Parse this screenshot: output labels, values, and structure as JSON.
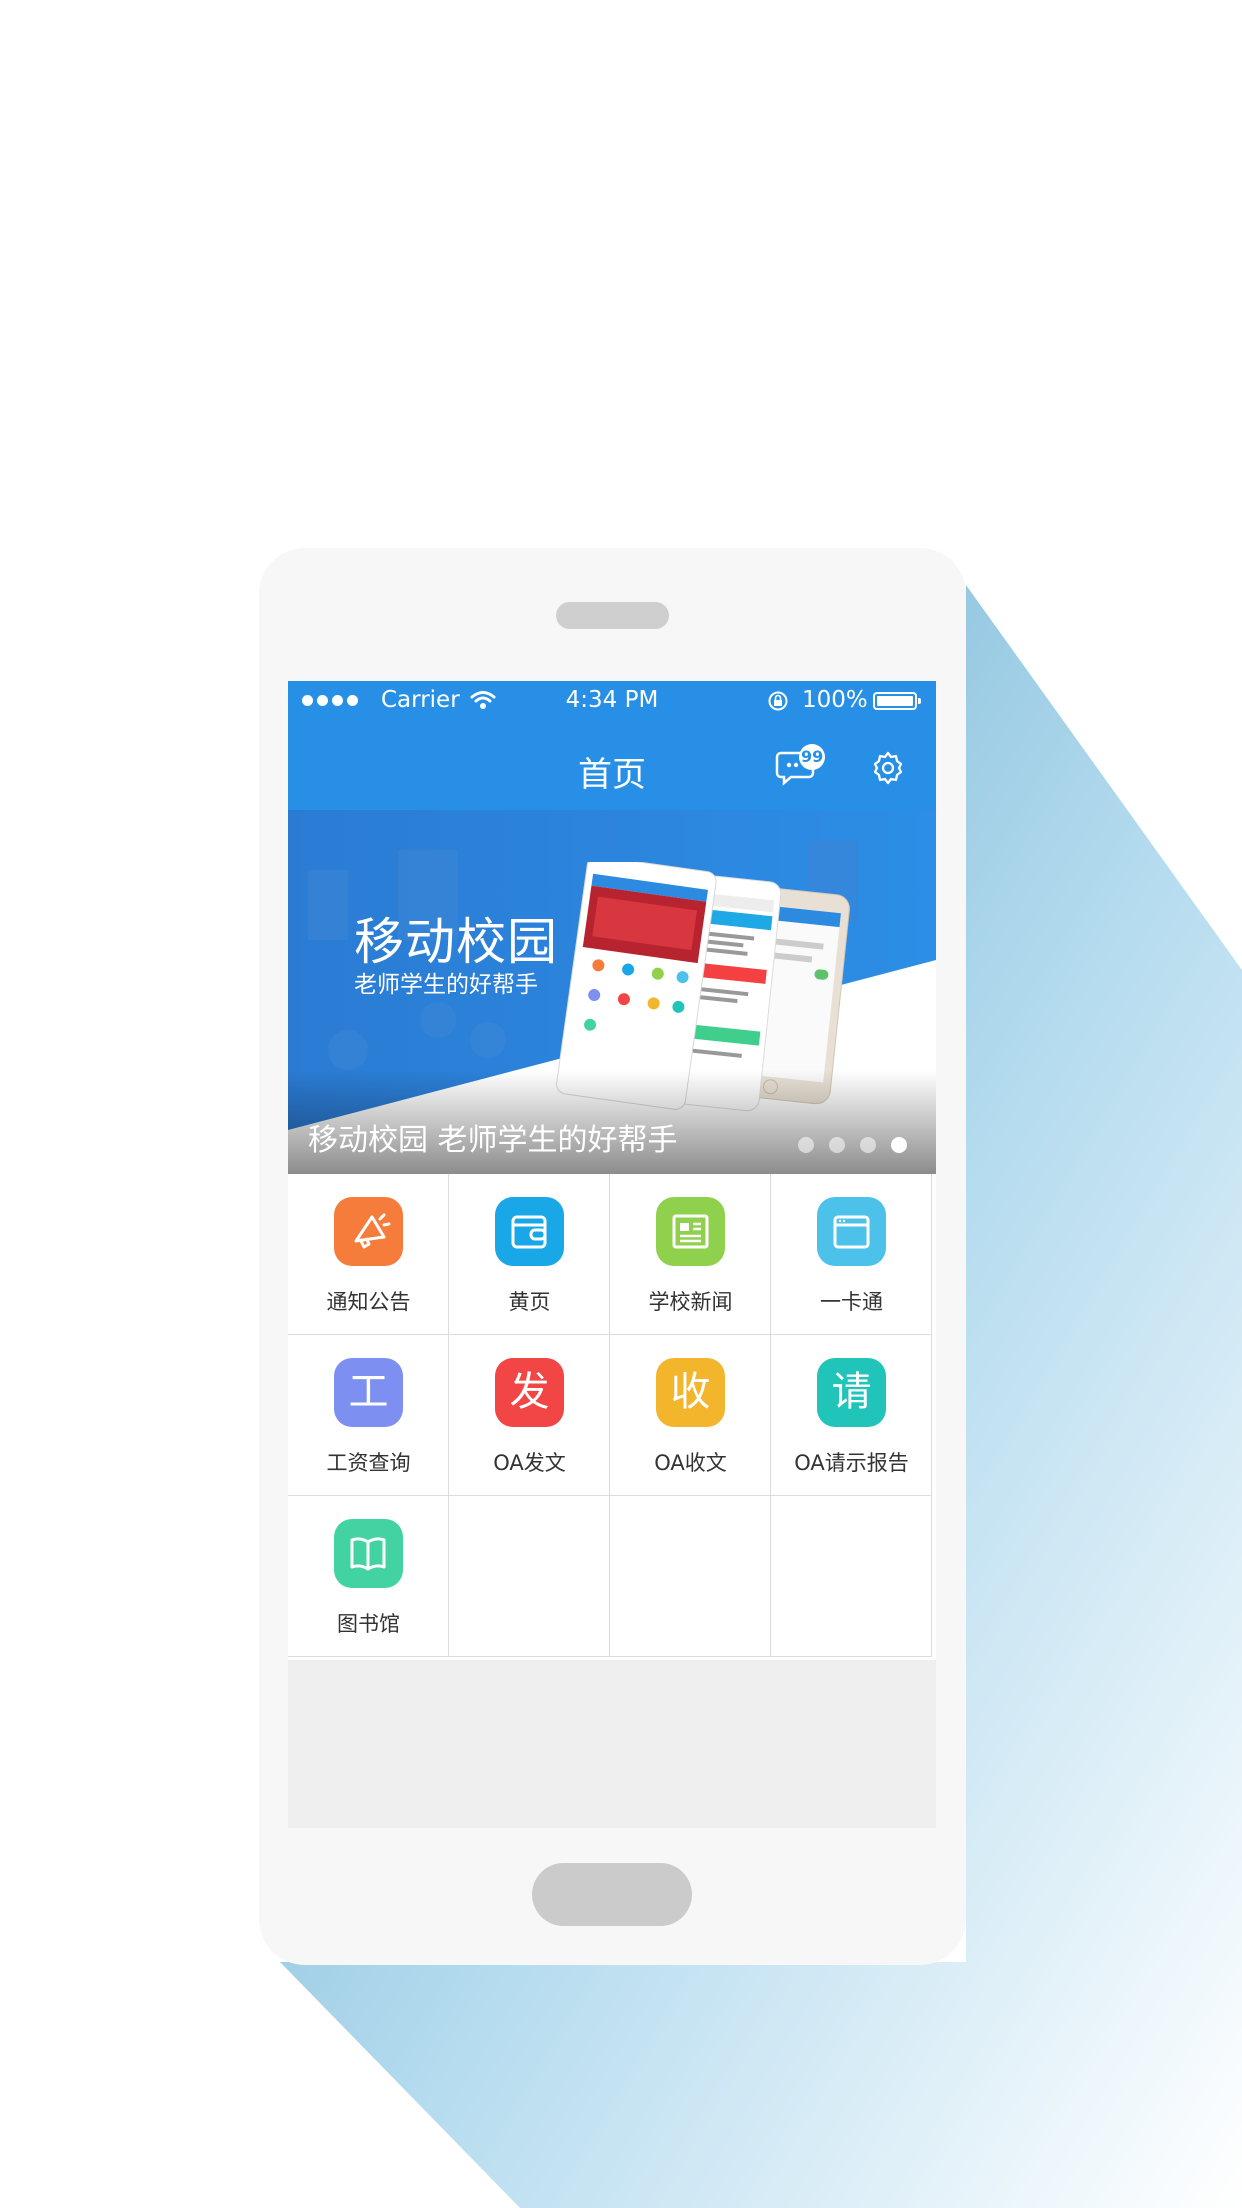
{
  "status_bar": {
    "carrier": "Carrier",
    "time": "4:34 PM",
    "battery": "100%"
  },
  "nav": {
    "title": "首页",
    "message_badge": "99"
  },
  "banner": {
    "headline": "移动校园",
    "subline": "老师学生的好帮手",
    "caption": "移动校园 老师学生的好帮手",
    "page_count": 4,
    "active_page": 4
  },
  "grid": {
    "items": [
      {
        "label": "通知公告",
        "icon": "megaphone-icon",
        "color": "#f57c3b"
      },
      {
        "label": "黄页",
        "icon": "wallet-icon",
        "color": "#19a7e8"
      },
      {
        "label": "学校新闻",
        "icon": "newspaper-icon",
        "color": "#8fd14c"
      },
      {
        "label": "一卡通",
        "icon": "card-window-icon",
        "color": "#4cc1ea"
      },
      {
        "label": "工资查询",
        "icon_text": "工",
        "color": "#7d8ff0"
      },
      {
        "label": "OA发文",
        "icon_text": "发",
        "color": "#f24545"
      },
      {
        "label": "OA收文",
        "icon_text": "收",
        "color": "#f2b52c"
      },
      {
        "label": "OA请示报告",
        "icon_text": "请",
        "color": "#21c4b8"
      },
      {
        "label": "图书馆",
        "icon": "book-icon",
        "color": "#43d3a2"
      }
    ]
  },
  "colors": {
    "brand_blue": "#2790e6",
    "shadow_blue": "#6aaed0"
  }
}
